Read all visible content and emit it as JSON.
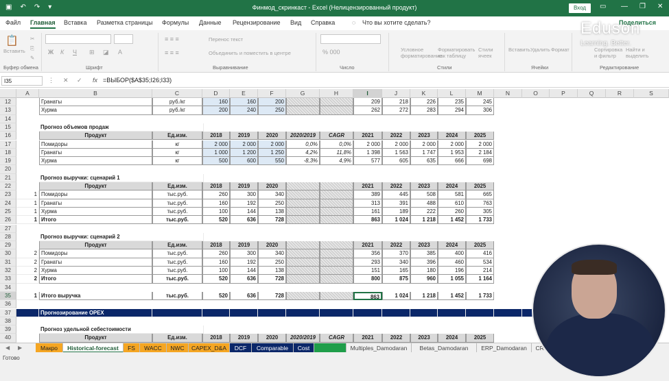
{
  "titlebar": {
    "title": "Финмод_скринкаст  -  Excel (Нелицензированный продукт)",
    "login": "Вход"
  },
  "tabs": [
    "Файл",
    "Главная",
    "Вставка",
    "Разметка страницы",
    "Формулы",
    "Данные",
    "Рецензирование",
    "Вид",
    "Справка",
    "Что вы хотите сделать?",
    "Поделиться"
  ],
  "ribbon": {
    "groups": [
      "Буфер обмена",
      "Шрифт",
      "Выравнивание",
      "Число",
      "Стили",
      "Ячейки",
      "Редактирование"
    ],
    "wrap": "Перенос текст",
    "merge": "Объединить и поместить в центре",
    "paste": "Вставить",
    "cond": "Условное форматирование",
    "fmt_table": "Форматировать как таблицу",
    "styles": "Стили ячеек",
    "insert": "Вставить",
    "delete": "Удалить",
    "format": "Формат",
    "sort": "Сортировка и фильтр",
    "find": "Найти и выделить"
  },
  "watermark": {
    "brand": "Eduson",
    "tagline": "Learning. Better."
  },
  "formula": {
    "name": "I35",
    "text": "=ВЫБОР($A$35;I26;I33)"
  },
  "columns": [
    "A",
    "B",
    "C",
    "D",
    "E",
    "F",
    "G",
    "H",
    "I",
    "J",
    "K",
    "L",
    "M",
    "N",
    "O",
    "P",
    "Q",
    "R",
    "S"
  ],
  "rows": [
    {
      "n": "12",
      "cells": {
        "B": "Гранаты",
        "C": "руб./кг",
        "D": "160",
        "E": "160",
        "F": "200",
        "I": "209",
        "J": "218",
        "K": "226",
        "L": "235",
        "M": "245"
      }
    },
    {
      "n": "13",
      "cells": {
        "B": "Хурма",
        "C": "руб./кг",
        "D": "200",
        "E": "240",
        "F": "250",
        "I": "262",
        "J": "272",
        "K": "283",
        "L": "294",
        "M": "306"
      }
    },
    {
      "n": "14",
      "cells": {}
    },
    {
      "n": "15",
      "cells": {
        "B": "Прогноз объемов продаж"
      }
    },
    {
      "n": "16",
      "cells": {
        "B": "Продукт",
        "C": "Ед.изм.",
        "D": "2018",
        "E": "2019",
        "F": "2020",
        "G": "2020/2019",
        "H": "CAGR",
        "I": "2021",
        "J": "2022",
        "K": "2023",
        "L": "2024",
        "M": "2025"
      }
    },
    {
      "n": "17",
      "cells": {
        "B": "Помидоры",
        "C": "кг",
        "D": "2 000",
        "E": "2 000",
        "F": "2 000",
        "G": "0,0%",
        "H": "0,0%",
        "I": "2 000",
        "J": "2 000",
        "K": "2 000",
        "L": "2 000",
        "M": "2 000"
      }
    },
    {
      "n": "18",
      "cells": {
        "B": "Гранаты",
        "C": "кг",
        "D": "1 000",
        "E": "1 200",
        "F": "1 250",
        "G": "4,2%",
        "H": "11,8%",
        "I": "1 398",
        "J": "1 563",
        "K": "1 747",
        "L": "1 953",
        "M": "2 184"
      }
    },
    {
      "n": "19",
      "cells": {
        "B": "Хурма",
        "C": "кг",
        "D": "500",
        "E": "600",
        "F": "550",
        "G": "-8,3%",
        "H": "4,9%",
        "I": "577",
        "J": "605",
        "K": "635",
        "L": "666",
        "M": "698"
      }
    },
    {
      "n": "20",
      "cells": {}
    },
    {
      "n": "21",
      "cells": {
        "B": "Прогноз выручки: сценарий 1"
      }
    },
    {
      "n": "22",
      "cells": {
        "B": "Продукт",
        "C": "Ед.изм.",
        "D": "2018",
        "E": "2019",
        "F": "2020",
        "I": "2021",
        "J": "2022",
        "K": "2023",
        "L": "2024",
        "M": "2025"
      }
    },
    {
      "n": "23",
      "cells": {
        "A": "1",
        "B": "Помидоры",
        "C": "тыс.руб.",
        "D": "260",
        "E": "300",
        "F": "340",
        "I": "389",
        "J": "445",
        "K": "508",
        "L": "581",
        "M": "665"
      }
    },
    {
      "n": "24",
      "cells": {
        "A": "1",
        "B": "Гранаты",
        "C": "тыс.руб.",
        "D": "160",
        "E": "192",
        "F": "250",
        "I": "313",
        "J": "391",
        "K": "488",
        "L": "610",
        "M": "763"
      }
    },
    {
      "n": "25",
      "cells": {
        "A": "1",
        "B": "Хурма",
        "C": "тыс.руб.",
        "D": "100",
        "E": "144",
        "F": "138",
        "I": "161",
        "J": "189",
        "K": "222",
        "L": "260",
        "M": "305"
      }
    },
    {
      "n": "26",
      "cells": {
        "A": "1",
        "B": "Итого",
        "C": "тыс.руб.",
        "D": "520",
        "E": "636",
        "F": "728",
        "I": "863",
        "J": "1 024",
        "K": "1 218",
        "L": "1 452",
        "M": "1 733"
      }
    },
    {
      "n": "27",
      "cells": {}
    },
    {
      "n": "28",
      "cells": {
        "B": "Прогноз выручки: сценарий 2"
      }
    },
    {
      "n": "29",
      "cells": {
        "B": "Продукт",
        "C": "Ед.изм.",
        "D": "2018",
        "E": "2019",
        "F": "2020",
        "I": "2021",
        "J": "2022",
        "K": "2023",
        "L": "2024",
        "M": "2025"
      }
    },
    {
      "n": "30",
      "cells": {
        "A": "2",
        "B": "Помидоры",
        "C": "тыс.руб.",
        "D": "260",
        "E": "300",
        "F": "340",
        "I": "356",
        "J": "370",
        "K": "385",
        "L": "400",
        "M": "416"
      }
    },
    {
      "n": "31",
      "cells": {
        "A": "2",
        "B": "Гранаты",
        "C": "тыс.руб.",
        "D": "160",
        "E": "192",
        "F": "250",
        "I": "293",
        "J": "340",
        "K": "396",
        "L": "460",
        "M": "534"
      }
    },
    {
      "n": "32",
      "cells": {
        "A": "2",
        "B": "Хурма",
        "C": "тыс.руб.",
        "D": "100",
        "E": "144",
        "F": "138",
        "I": "151",
        "J": "165",
        "K": "180",
        "L": "196",
        "M": "214"
      }
    },
    {
      "n": "33",
      "cells": {
        "A": "2",
        "B": "Итого",
        "C": "тыс.руб.",
        "D": "520",
        "E": "636",
        "F": "728",
        "I": "800",
        "J": "875",
        "K": "960",
        "L": "1 055",
        "M": "1 164"
      }
    },
    {
      "n": "34",
      "cells": {}
    },
    {
      "n": "35",
      "cells": {
        "A": "1",
        "B": "Итого выручка",
        "C": "тыс.руб.",
        "D": "520",
        "E": "636",
        "F": "728",
        "I": "863",
        "J": "1 024",
        "K": "1 218",
        "L": "1 452",
        "M": "1 733"
      }
    },
    {
      "n": "36",
      "cells": {}
    },
    {
      "n": "37",
      "cells": {
        "B": "Прогнозирование OPEX"
      }
    },
    {
      "n": "38",
      "cells": {}
    },
    {
      "n": "39",
      "cells": {
        "B": "Прогноз удельной себестоимости"
      }
    },
    {
      "n": "40",
      "cells": {
        "B": "Продукт",
        "C": "Ед.изм.",
        "D": "2018",
        "E": "2019",
        "F": "2020",
        "G": "2020/2019",
        "H": "CAGR",
        "I": "2021",
        "J": "2022",
        "K": "2023",
        "L": "2024",
        "M": "2025"
      }
    }
  ],
  "sheet_tabs": [
    "Макро",
    "Historical-forecast",
    "FS",
    "WACC",
    "NWC",
    "CAPEX_D&A",
    "DCF",
    "Comparable",
    "Cost",
    "",
    "Multiples_Damodaran",
    "Betas_Damodaran",
    "ERP_Damodaran",
    "CRS"
  ],
  "status": {
    "ready": "Готово"
  },
  "colors": {
    "excel_green": "#217346",
    "navy": "#0b2769",
    "orange_tab": "#f5a623",
    "green_tab": "#1f9e4a"
  }
}
